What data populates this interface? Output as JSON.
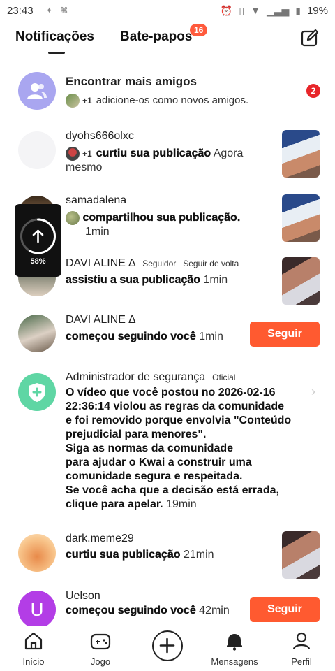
{
  "status_bar": {
    "time": "23:43",
    "battery": "19%"
  },
  "header": {
    "tab_notifications": "Notificações",
    "tab_chats": "Bate-papos",
    "chats_badge": "16"
  },
  "notifications": [
    {
      "name": "Encontrar mais amigos",
      "plus": "+1",
      "text": "adicione-os como novos amigos.",
      "badge": "2"
    },
    {
      "name": "dyohs666olxc",
      "plus": "+1",
      "action": "curtiu sua publicação",
      "time": "Agora mesmo"
    },
    {
      "name": "samadalena",
      "action": "compartilhou sua publicação.",
      "time": "1min"
    },
    {
      "name": "DAVI ALINE ∆",
      "tag1": "Seguidor",
      "tag2": "Seguir de volta",
      "action": "assistiu a sua publicação",
      "time": "1min"
    },
    {
      "name": "DAVI ALINE ∆",
      "action": "começou seguindo você",
      "time": "1min",
      "button": "Seguir"
    },
    {
      "name": "Administrador de segurança",
      "tag1": "Oficial",
      "lines": [
        "O vídeo que você postou no 2026-02-16",
        "22:36:14 violou as regras da comunidade",
        "e foi removido porque envolvia \"Conteúdo",
        "prejudicial para menores\".",
        "Siga as normas da comunidade",
        "para ajudar o Kwai a construir uma",
        "comunidade segura e respeitada.",
        "Se você acha que a decisão está errada,",
        "clique para apelar."
      ],
      "time": "19min"
    },
    {
      "name": "dark.meme29",
      "action": "curtiu sua publicação",
      "time": "21min"
    },
    {
      "name": "Uelson",
      "avatar_letter": "U",
      "action": "começou seguindo você",
      "time": "42min",
      "button": "Seguir"
    }
  ],
  "upload": {
    "progress_label": "58%",
    "progress": 0.58
  },
  "bottom_nav": {
    "home": "Início",
    "games": "Jogo",
    "messages": "Mensagens",
    "profile": "Perfil"
  },
  "colors": {
    "accent": "#ff5a30",
    "badge_red": "#e8262a",
    "friends_purple": "#a9a6f0",
    "security_green": "#5fd6a4",
    "uelson_purple": "#b33de6"
  }
}
